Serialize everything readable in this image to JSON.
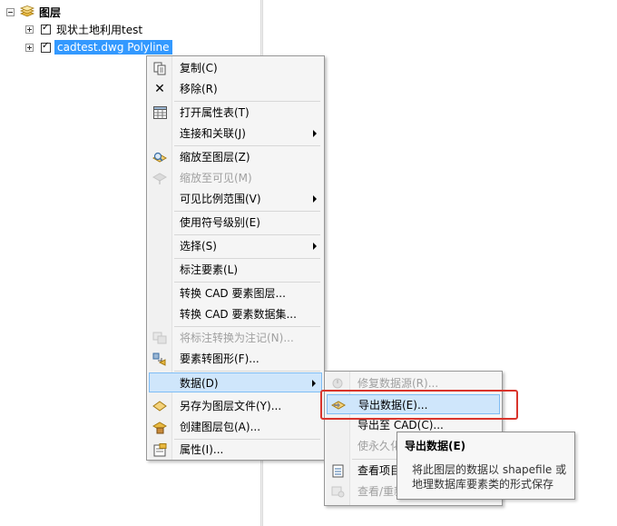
{
  "toc": {
    "root_label": "图层",
    "layers": [
      {
        "label": "现状土地利用test",
        "checked": true
      },
      {
        "label": "cadtest.dwg Polyline",
        "checked": true,
        "selected": true
      }
    ]
  },
  "context_menu": {
    "items": [
      {
        "label": "复制(C)",
        "icon": "copy-icon"
      },
      {
        "label": "移除(R)",
        "icon": "remove-x-icon"
      },
      {
        "label": "打开属性表(T)",
        "icon": "table-icon"
      },
      {
        "label": "连接和关联(J)",
        "submenu": true
      },
      {
        "label": "缩放至图层(Z)",
        "icon": "zoom-to-layer-icon"
      },
      {
        "label": "缩放至可见(M)",
        "icon": "zoom-to-visible-icon",
        "disabled": true
      },
      {
        "label": "可见比例范围(V)",
        "submenu": true
      },
      {
        "label": "使用符号级别(E)"
      },
      {
        "label": "选择(S)",
        "submenu": true
      },
      {
        "label": "标注要素(L)"
      },
      {
        "label": "转换 CAD 要素图层..."
      },
      {
        "label": "转换 CAD 要素数据集..."
      },
      {
        "label": "将标注转换为注记(N)...",
        "icon": "annotation-icon",
        "disabled": true
      },
      {
        "label": "要素转图形(F)...",
        "icon": "features-to-graphics-icon"
      },
      {
        "label": "数据(D)",
        "submenu": true,
        "active": true
      },
      {
        "label": "另存为图层文件(Y)...",
        "icon": "layer-file-icon"
      },
      {
        "label": "创建图层包(A)...",
        "icon": "layer-package-icon"
      },
      {
        "label": "属性(I)...",
        "icon": "properties-icon"
      }
    ]
  },
  "data_submenu": {
    "items": [
      {
        "label": "修复数据源(R)...",
        "icon": "repair-data-source-icon",
        "disabled": true
      },
      {
        "label": "导出数据(E)...",
        "icon": "export-data-icon",
        "hover": true
      },
      {
        "label": "导出至 CAD(C)..."
      },
      {
        "label": "使永久化",
        "disabled": true
      },
      {
        "label": "查看项目",
        "icon": "view-item-icon"
      },
      {
        "label": "查看/重新",
        "icon": "view-reset-icon",
        "disabled": true
      }
    ]
  },
  "tooltip": {
    "title": "导出数据(E)",
    "body": "将此图层的数据以 shapefile 或地理数据库要素类的形式保存"
  },
  "colors": {
    "selection": "#3399ff",
    "hover_bg": "#cfe6fb",
    "highlight_box": "#d9342b"
  }
}
